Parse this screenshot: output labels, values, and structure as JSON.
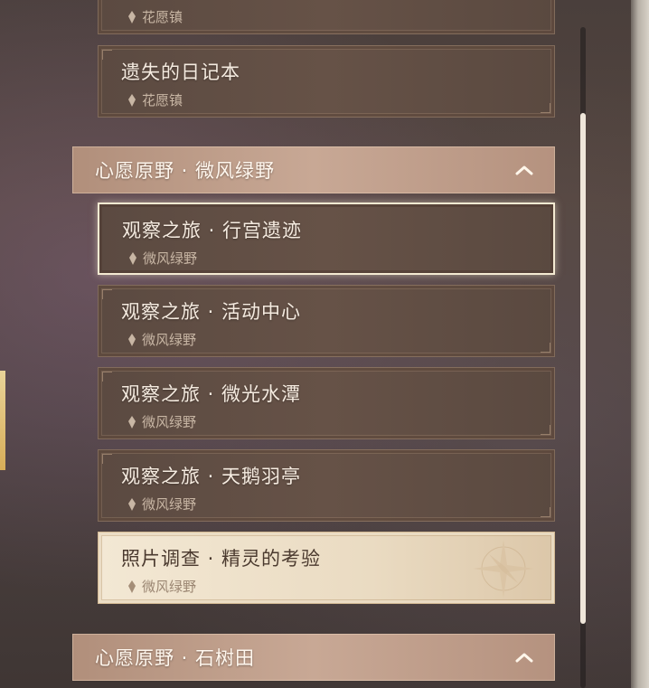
{
  "quest_list": {
    "top_partial_card": {
      "location": "花愿镇"
    },
    "cards_top": [
      {
        "title": "遗失的日记本",
        "location": "花愿镇"
      }
    ],
    "groups": [
      {
        "title": "心愿原野 · 微风绿野",
        "expanded": true,
        "items": [
          {
            "title": "观察之旅 · 行宫遗迹",
            "location": "微风绿野",
            "state": "selected"
          },
          {
            "title": "观察之旅 · 活动中心",
            "location": "微风绿野",
            "state": "normal"
          },
          {
            "title": "观察之旅 · 微光水潭",
            "location": "微风绿野",
            "state": "normal"
          },
          {
            "title": "观察之旅 · 天鹅羽亭",
            "location": "微风绿野",
            "state": "normal"
          },
          {
            "title": "照片调查 · 精灵的考验",
            "location": "微风绿野",
            "state": "highlighted"
          }
        ]
      },
      {
        "title": "心愿原野 · 石树田",
        "expanded": true
      }
    ]
  },
  "icons": {
    "location": "location-pin-icon",
    "collapse": "chevron-up-icon"
  },
  "colors": {
    "header": "#c0a08c",
    "card": "#5f4d43",
    "card_light": "#efe2cb",
    "selected_border": "#f4ead2"
  }
}
